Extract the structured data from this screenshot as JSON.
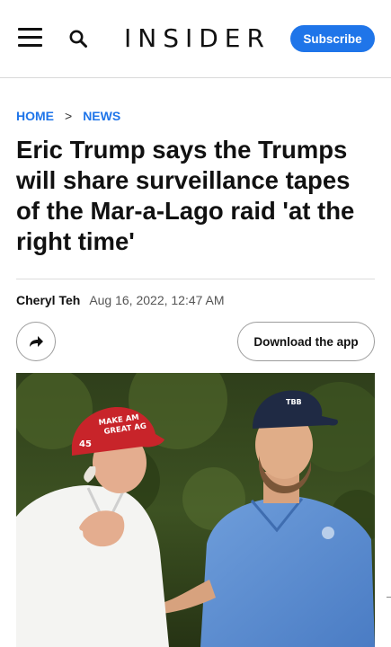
{
  "header": {
    "logo": "INSIDER",
    "subscribe_label": "Subscribe",
    "menu_icon": "hamburger-menu-icon",
    "search_icon": "search-icon"
  },
  "breadcrumb": {
    "home": "HOME",
    "separator": ">",
    "news": "NEWS"
  },
  "article": {
    "title": "Eric Trump says the Trumps will share surveillance tapes of the Mar-a-Lago raid 'at the right time'",
    "author": "Cheryl Teh",
    "date": "Aug 16, 2022, 12:47 AM"
  },
  "actions": {
    "share_icon": "share-arrow-icon",
    "download_label": "Download the app"
  },
  "hero": {
    "cap_text_1": "MAKE AM",
    "cap_text_2": "GREAT AG",
    "cap_number": "45",
    "cap_right_text": "TBB"
  },
  "colors": {
    "accent": "#1f75e9",
    "text": "#111111",
    "muted": "#555555"
  }
}
